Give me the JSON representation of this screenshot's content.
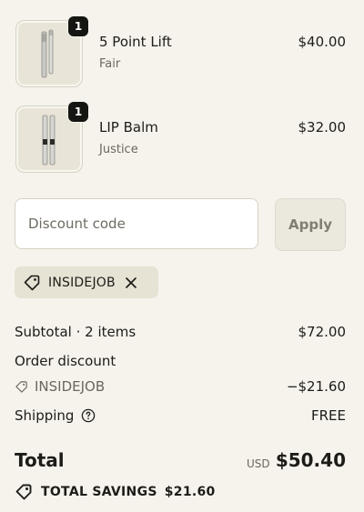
{
  "cart": {
    "items": [
      {
        "name": "5 Point Lift",
        "variant": "Fair",
        "price": "$40.00",
        "quantity": "1",
        "image_icon": "makeup-pencil-icon"
      },
      {
        "name": "LIP Balm",
        "variant": "Justice",
        "price": "$32.00",
        "quantity": "1",
        "image_icon": "lip-balm-icon"
      }
    ]
  },
  "discount": {
    "placeholder": "Discount code",
    "value": "",
    "apply_label": "Apply",
    "applied_code": "INSIDEJOB"
  },
  "summary": {
    "subtotal_label": "Subtotal · 2 items",
    "subtotal_value": "$72.00",
    "order_discount_label": "Order discount",
    "discount_code": "INSIDEJOB",
    "discount_value": "−$21.60",
    "shipping_label": "Shipping",
    "shipping_value": "FREE",
    "total_label": "Total",
    "currency": "USD",
    "total_value": "$50.40",
    "savings_label": "TOTAL SAVINGS",
    "savings_value": "$21.60"
  },
  "colors": {
    "background": "#f5f3ec",
    "text": "#1d1c18",
    "muted_text": "#6a675e",
    "badge": "#151512",
    "tag_background": "#e6e3d5"
  }
}
